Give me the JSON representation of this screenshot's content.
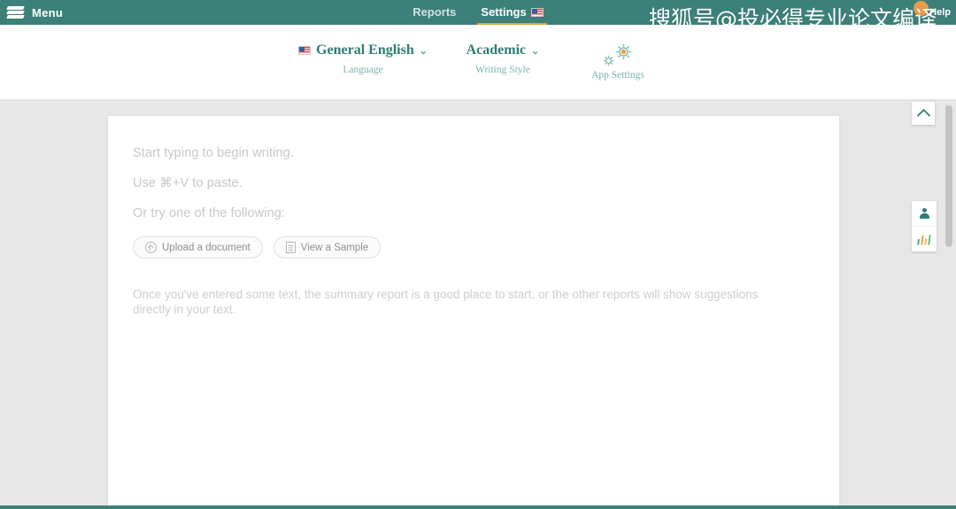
{
  "topbar": {
    "menu_label": "Menu",
    "logo_icon": "stacked-layers-logo",
    "nav": [
      {
        "label": "Reports",
        "active": false
      },
      {
        "label": "Settings",
        "active": true,
        "flag_icon": "us-flag-icon"
      }
    ],
    "help_label": "Help",
    "help_badge_color": "#e89a4a",
    "bar_color": "#3c8079",
    "active_underline_color": "#e8a33d"
  },
  "watermark": {
    "text": "搜狐号@投必得专业论文编译"
  },
  "settings_bar": {
    "items": [
      {
        "value": "General English",
        "label": "Language",
        "icon": "us-flag-icon",
        "caret": "⌄"
      },
      {
        "value": "Academic",
        "label": "Writing Style",
        "caret": "⌄"
      },
      {
        "value": "",
        "label": "App Settings",
        "icon": "gears-icon"
      }
    ],
    "accent_color": "#2f7d74",
    "label_color": "#78b5ad"
  },
  "document": {
    "hints": [
      "Start typing to begin writing.",
      "Use ⌘+V to paste.",
      "Or try one of the following:"
    ],
    "buttons": [
      {
        "label": "Upload a document",
        "icon": "upload-circle-icon"
      },
      {
        "label": "View a Sample",
        "icon": "document-icon"
      }
    ],
    "summary": "Once you've entered some text, the summary report is a good place to start, or the other reports will show suggestions directly in your text."
  },
  "right_rail": {
    "scroll_top_icon": "chevron-up-icon",
    "buttons": [
      {
        "icon": "person-icon",
        "name": "audience-report"
      },
      {
        "icon": "bar-chart-icon",
        "name": "statistics-report"
      }
    ],
    "bar_colors": [
      "#4aa3b8",
      "#e8a33d",
      "#f0c04a",
      "#6fbf7e"
    ]
  }
}
